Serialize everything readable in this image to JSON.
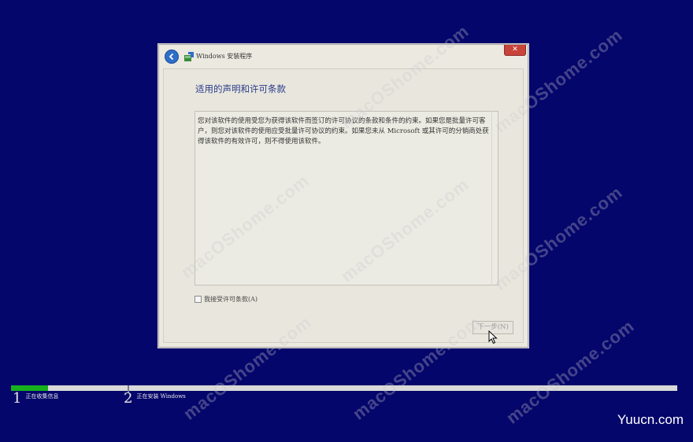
{
  "window": {
    "title": "Windows 安装程序",
    "close_label": "✕"
  },
  "page": {
    "heading": "适用的声明和许可条款",
    "license_text": "您对该软件的使用受您为获得该软件而签订的许可协议的条款和条件的约束。如果您是批量许可客户，则您对该软件的使用应受批量许可协议的约束。如果您未从 Microsoft 或其许可的分销商处获得该软件的有效许可，则不得使用该软件。",
    "accept_label": "我接受许可条款(A)",
    "accept_checked": false,
    "next_button": "下一步(N)",
    "next_enabled": false
  },
  "progress": {
    "fraction": 0.056,
    "steps": [
      {
        "number": "1",
        "label": "正在收集信息"
      },
      {
        "number": "2",
        "label": "正在安装 Windows"
      }
    ]
  },
  "watermark": "macOShome.com",
  "site_logo": "Yuucn.com",
  "colors": {
    "background": "#05066b",
    "progress_fill": "#18b11e",
    "heading": "#2a3a8c"
  },
  "icons": {
    "back": "back-arrow-icon",
    "setup": "windows-setup-icon",
    "close": "close-icon",
    "cursor": "mouse-pointer-icon"
  }
}
